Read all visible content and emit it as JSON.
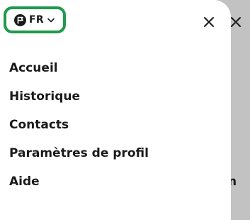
{
  "language": {
    "code": "FR"
  },
  "menu": {
    "items": [
      {
        "label": "Accueil"
      },
      {
        "label": "Historique"
      },
      {
        "label": "Contacts"
      },
      {
        "label": "Paramètres de profil"
      },
      {
        "label": "Aide"
      }
    ]
  },
  "backdrop": {
    "partial_text": "n"
  },
  "colors": {
    "accent": "#1f9a4a",
    "text": "#1a1a1a",
    "backdrop": "#c2c2c2"
  },
  "icons": {
    "language": "flag-icon",
    "dropdown": "chevron-down-icon",
    "close": "close-icon"
  }
}
